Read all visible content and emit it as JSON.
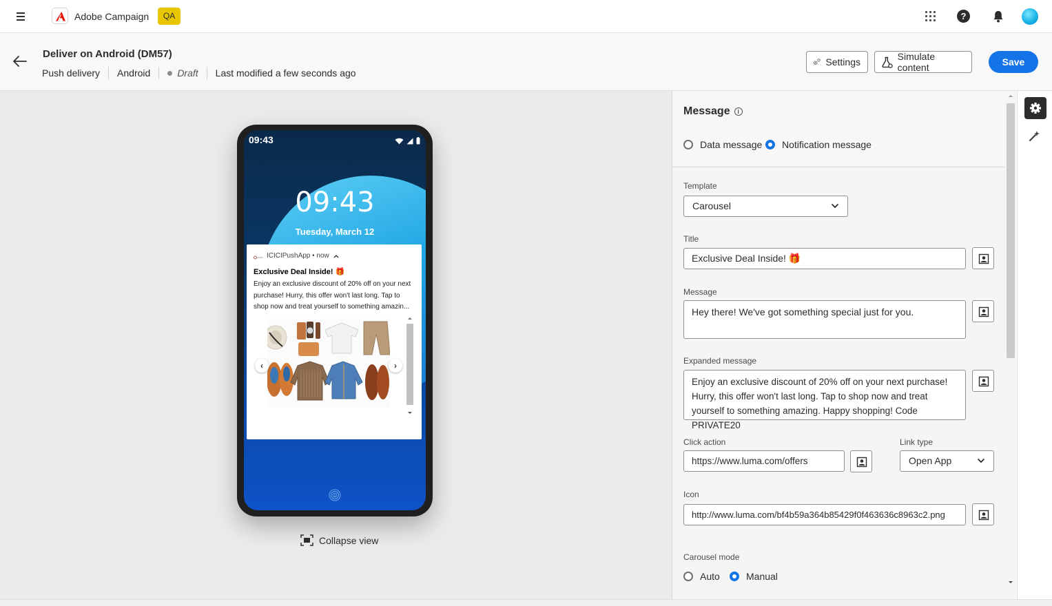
{
  "topbar": {
    "app_name": "Adobe Campaign",
    "env_badge": "QA",
    "icons": [
      "menu-icon",
      "adobe-logo",
      "apps-grid-icon",
      "help-icon",
      "notifications-bell-icon",
      "user-avatar"
    ]
  },
  "header": {
    "title": "Deliver on Android (DM57)",
    "meta": {
      "channel": "Push delivery",
      "platform": "Android",
      "status": "Draft",
      "modified": "Last modified a few seconds ago"
    },
    "buttons": {
      "settings": "Settings",
      "simulate": "Simulate content",
      "save": "Save"
    }
  },
  "preview": {
    "status_time": "09:43",
    "lock_time": "09:43",
    "lock_date": "Tuesday, March 12",
    "notification": {
      "app_line": "ICICIPushApp • now",
      "title": "Exclusive Deal Inside! 🎁",
      "body": "Enjoy an exclusive discount of 20% off on your next purchase! Hurry, this offer won't last long. Tap to shop now and treat yourself to something amazin..."
    },
    "collapse_label": "Collapse view"
  },
  "panel": {
    "heading": "Message",
    "message_types": [
      {
        "label": "Data message",
        "selected": false
      },
      {
        "label": "Notification message",
        "selected": true
      }
    ],
    "template": {
      "label": "Template",
      "value": "Carousel"
    },
    "title_field": {
      "label": "Title",
      "value": "Exclusive Deal Inside! 🎁"
    },
    "message_field": {
      "label": "Message",
      "value": "Hey there! We've got something special just for you."
    },
    "expanded_field": {
      "label": "Expanded message",
      "value": "Enjoy an exclusive discount of 20% off on your next purchase! Hurry, this offer won't last long. Tap to shop now and treat yourself to something amazing. Happy shopping! Code PRIVATE20"
    },
    "click_action": {
      "label": "Click action",
      "value": "https://www.luma.com/offers"
    },
    "link_type": {
      "label": "Link type",
      "value": "Open App"
    },
    "icon_field": {
      "label": "Icon",
      "value": "http://www.luma.com/bf4b59a364b85429f0f463636c8963c2.png"
    },
    "carousel_mode": {
      "label": "Carousel mode",
      "options": [
        {
          "label": "Auto",
          "selected": false
        },
        {
          "label": "Manual",
          "selected": true
        }
      ]
    }
  },
  "colors": {
    "accent": "#1473e6",
    "badge": "#e8c600",
    "adobe_red": "#eb1000"
  }
}
